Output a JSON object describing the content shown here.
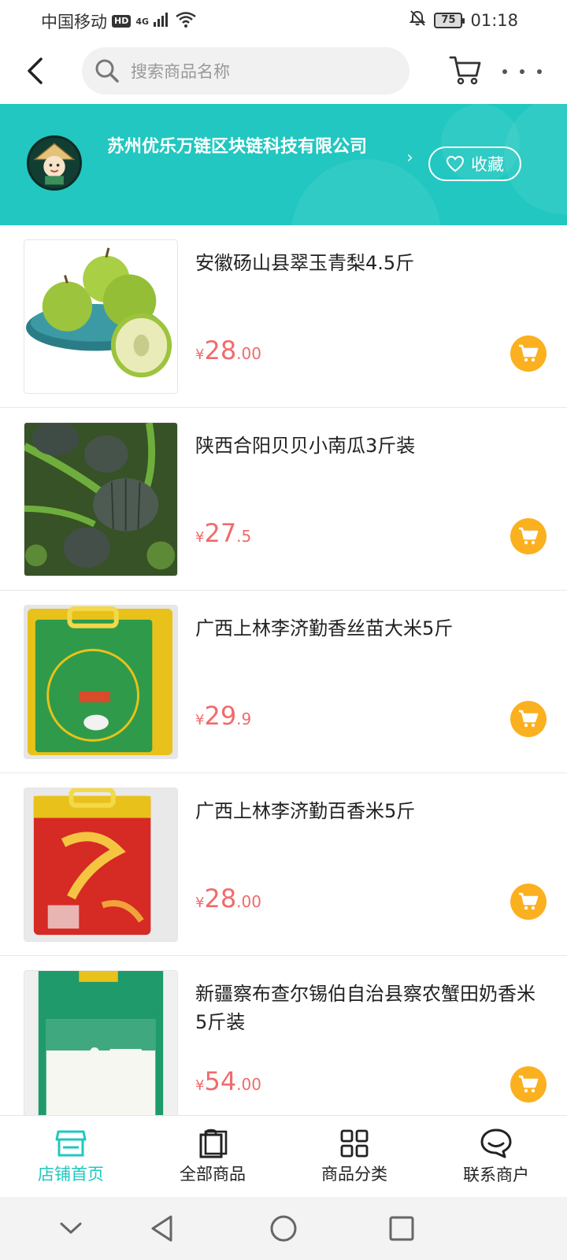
{
  "status_bar": {
    "carrier": "中国移动",
    "hd_badge": "HD",
    "network": "4G",
    "battery": "75",
    "time": "01:18"
  },
  "header": {
    "search_placeholder": "搜索商品名称"
  },
  "store": {
    "name": "苏州优乐万链区块链科技有限公司",
    "favorite_label": "收藏"
  },
  "products": [
    {
      "title": "安徽砀山县翠玉青梨4.5斤",
      "currency": "¥",
      "price_int": "28",
      "price_dec": ".00"
    },
    {
      "title": "陕西合阳贝贝小南瓜3斤装",
      "currency": "¥",
      "price_int": "27",
      "price_dec": ".5"
    },
    {
      "title": "广西上林李济勤香丝苗大米5斤",
      "currency": "¥",
      "price_int": "29",
      "price_dec": ".9"
    },
    {
      "title": "广西上林李济勤百香米5斤",
      "currency": "¥",
      "price_int": "28",
      "price_dec": ".00"
    },
    {
      "title": "新疆察布查尔锡伯自治县察农蟹田奶香米5斤装",
      "currency": "¥",
      "price_int": "54",
      "price_dec": ".00"
    }
  ],
  "tabs": [
    {
      "label": "店铺首页",
      "icon": "store-icon",
      "active": true
    },
    {
      "label": "全部商品",
      "icon": "shopping-bag-icon",
      "active": false
    },
    {
      "label": "商品分类",
      "icon": "category-grid-icon",
      "active": false
    },
    {
      "label": "联系商户",
      "icon": "chat-bubble-icon",
      "active": false
    }
  ],
  "colors": {
    "accent": "#21c7c0",
    "price": "#f06b6b",
    "cart_button": "#fbb01f"
  }
}
